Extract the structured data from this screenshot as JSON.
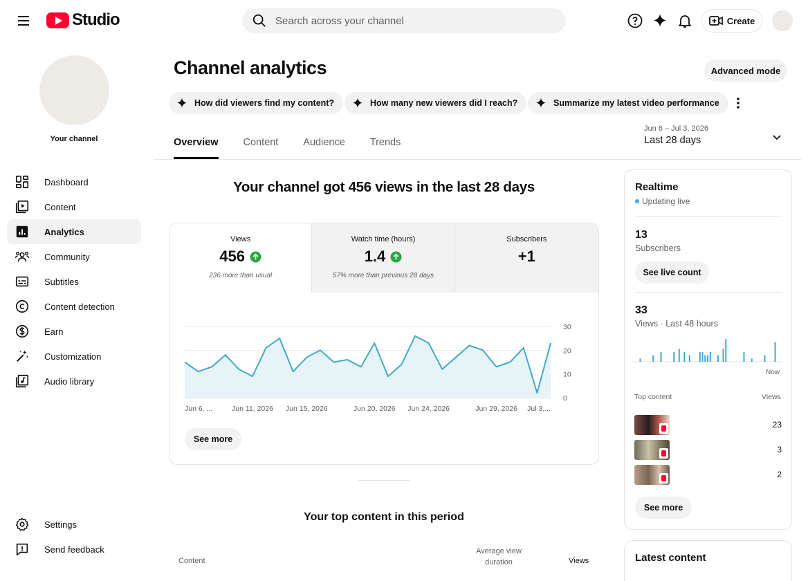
{
  "app": {
    "logo_text": "Studio",
    "brand_color": "#ff0033"
  },
  "search": {
    "placeholder": "Search across your channel"
  },
  "header": {
    "create_label": "Create"
  },
  "sidebar": {
    "channel_name": "Your channel",
    "items": [
      {
        "label": "Dashboard",
        "icon": "dashboard-icon"
      },
      {
        "label": "Content",
        "icon": "content-icon"
      },
      {
        "label": "Analytics",
        "icon": "analytics-icon",
        "active": true
      },
      {
        "label": "Community",
        "icon": "community-icon"
      },
      {
        "label": "Subtitles",
        "icon": "subtitles-icon"
      },
      {
        "label": "Content detection",
        "icon": "copyright-icon"
      },
      {
        "label": "Earn",
        "icon": "dollar-icon"
      },
      {
        "label": "Customization",
        "icon": "magic-wand-icon"
      },
      {
        "label": "Audio library",
        "icon": "audio-library-icon"
      }
    ],
    "bottom_items": [
      {
        "label": "Settings",
        "icon": "gear-icon"
      },
      {
        "label": "Send feedback",
        "icon": "feedback-icon"
      }
    ]
  },
  "main": {
    "title": "Channel analytics",
    "advanced_mode_label": "Advanced mode",
    "suggestions": [
      "How did viewers find my content?",
      "How many new viewers did I reach?",
      "Summarize my latest video performance"
    ],
    "tabs": [
      "Overview",
      "Content",
      "Audience",
      "Trends"
    ],
    "active_tab": "Overview",
    "date_range": {
      "dates": "Jun 6 – Jul 3, 2026",
      "label": "Last 28 days"
    },
    "headline": "Your channel got 456 views in the last 28 days",
    "metrics": [
      {
        "label": "Views",
        "value": "456",
        "trend": "up",
        "note": "236 more than usual",
        "selected": true
      },
      {
        "label": "Watch time (hours)",
        "value": "1.4",
        "trend": "up",
        "note": "57% more than previous 28 days"
      },
      {
        "label": "Subscribers",
        "value": "+1"
      }
    ],
    "see_more_label": "See more",
    "top_content": {
      "title": "Your top content in this period",
      "col_content": "Content",
      "col_avg_line1": "Average view",
      "col_avg_line2": "duration",
      "col_views": "Views"
    }
  },
  "chart_data": {
    "type": "area",
    "series": [
      {
        "values": [
          15,
          11,
          13,
          18,
          12,
          9,
          21,
          25,
          11,
          17,
          20,
          15,
          16,
          13,
          23,
          9,
          14,
          26,
          23,
          12,
          17,
          22,
          20,
          13,
          15,
          21,
          2,
          23
        ]
      }
    ],
    "x_tick_labels": [
      "Jun 6, ...",
      "Jun 11, 2026",
      "Jun 15, 2026",
      "Jun 20, 2026",
      "Jun 24, 2026",
      "Jun 29, 2026",
      "Jul 3,..."
    ],
    "x_tick_index": [
      0,
      5,
      9,
      14,
      18,
      23,
      27
    ],
    "y_ticks": [
      0,
      10,
      20,
      30
    ],
    "ylim": [
      0,
      30
    ],
    "line_color": "#41a8cd",
    "fill_color": "#e6f4f8",
    "grid": true
  },
  "realtime": {
    "title": "Realtime",
    "status": "Updating live",
    "subscribers_value": "13",
    "subscribers_label": "Subscribers",
    "live_count_label": "See live count",
    "views_value": "33",
    "views_label": "Views · Last 48 hours",
    "now_label": "Now",
    "top_content_label": "Top content",
    "views_col_label": "Views",
    "bar_values": [
      0,
      0,
      1,
      0,
      0,
      0,
      0,
      2,
      0,
      0,
      3,
      0,
      0,
      0,
      0,
      3,
      0,
      4,
      0,
      3,
      0,
      2,
      0,
      0,
      0,
      3,
      3,
      2,
      2,
      3,
      0,
      0,
      2,
      0,
      4,
      7,
      0,
      0,
      0,
      0,
      0,
      0,
      3,
      0,
      0,
      1,
      0,
      0,
      0,
      0,
      2,
      0,
      0,
      0,
      6,
      0
    ],
    "top_items": [
      {
        "views": "23",
        "thumb_color": "#5b3a34"
      },
      {
        "views": "3",
        "thumb_color": "#8c7f6a"
      },
      {
        "views": "2",
        "thumb_color": "#9a7e6c"
      }
    ],
    "see_more_label": "See more"
  },
  "latest": {
    "title": "Latest content"
  }
}
